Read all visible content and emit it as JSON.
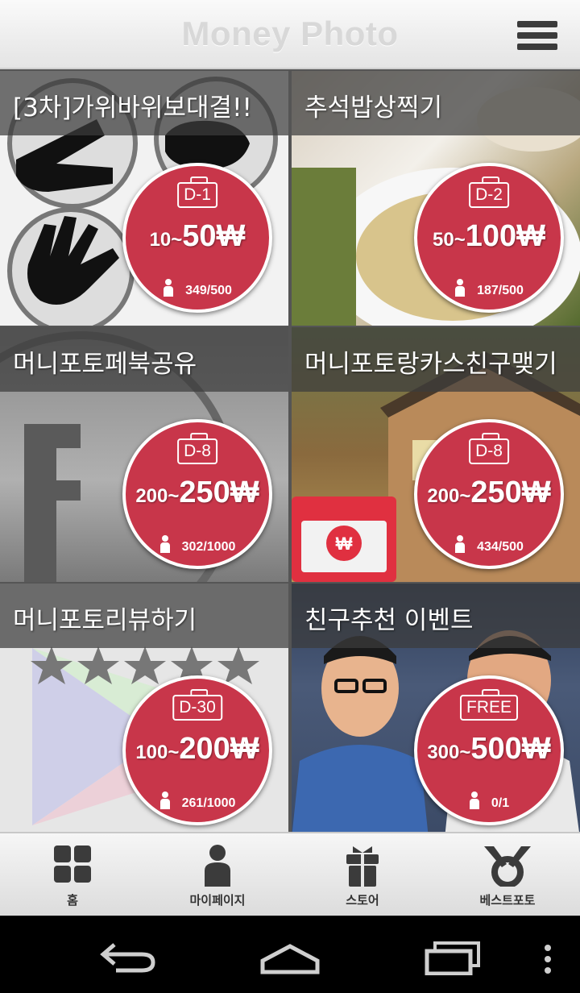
{
  "header": {
    "title": "Money Photo",
    "menu_icon": "hamburger-menu-icon"
  },
  "cards": [
    {
      "title": "[3차]가위바위보대결!!",
      "dday": "D-1",
      "price_min": "10~",
      "price_max": "50₩",
      "count": "349/500"
    },
    {
      "title": "추석밥상찍기",
      "dday": "D-2",
      "price_min": "50~",
      "price_max": "100₩",
      "count": "187/500"
    },
    {
      "title": "머니포토페북공유",
      "dday": "D-8",
      "price_min": "200~",
      "price_max": "250₩",
      "count": "302/1000"
    },
    {
      "title": "머니포토랑카스친구맺기",
      "dday": "D-8",
      "price_min": "200~",
      "price_max": "250₩",
      "count": "434/500"
    },
    {
      "title": "머니포토리뷰하기",
      "dday": "D-30",
      "price_min": "100~",
      "price_max": "200₩",
      "count": "261/1000"
    },
    {
      "title": "친구추천 이벤트",
      "dday": "FREE",
      "price_min": "300~",
      "price_max": "500₩",
      "count": "0/1"
    }
  ],
  "bottom_nav": [
    {
      "label": "홈",
      "icon": "grid-icon"
    },
    {
      "label": "마이페이지",
      "icon": "person-icon"
    },
    {
      "label": "스토어",
      "icon": "gift-icon"
    },
    {
      "label": "베스트포토",
      "icon": "medal-icon"
    }
  ],
  "system_nav": [
    "back-icon",
    "home-icon",
    "recent-apps-icon",
    "overflow-icon"
  ],
  "colors": {
    "badge": "#c8364a",
    "title_overlay": "#3c3c3c"
  }
}
